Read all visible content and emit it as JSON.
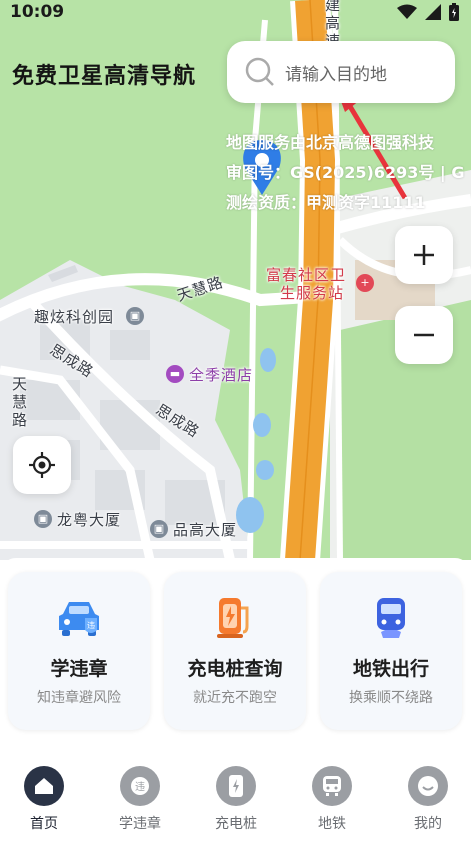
{
  "status": {
    "time": "10:09"
  },
  "app": {
    "title": "免费卫星高清导航"
  },
  "search": {
    "placeholder": "请输入目的地"
  },
  "map": {
    "attribution": [
      "地图服务由北京高德图强科技",
      "审图号：GS(2025)6293号 | G",
      "测绘资质：甲测资字11111"
    ],
    "road_labels": {
      "tianhui_road": "天慧路",
      "sicheng_road_a": "思成路",
      "sicheng_road_b": "思成路",
      "tianhui_road_v": "天慧路",
      "jiangao_road": "建高速"
    },
    "pois": {
      "quxuan": "趣炫科创园",
      "fuchun": "富春社区卫生服务站",
      "fuchun_line1": "富春社区卫",
      "fuchun_line2": "生服务站",
      "quanji": "全季酒店",
      "longyue": "龙粤大厦",
      "pingao": "品高大厦"
    },
    "buttons": {
      "zoom_in": "+",
      "zoom_out": "−"
    }
  },
  "cards": [
    {
      "title": "学违章",
      "subtitle": "知违章避风险",
      "icon": "car-violation-icon"
    },
    {
      "title": "充电桩查询",
      "subtitle": "就近充不跑空",
      "icon": "charging-pile-icon"
    },
    {
      "title": "地铁出行",
      "subtitle": "换乘顺不绕路",
      "icon": "subway-icon"
    }
  ],
  "nav": [
    {
      "label": "首页",
      "icon": "home-icon",
      "active": true
    },
    {
      "label": "学违章",
      "icon": "violation-icon",
      "active": false
    },
    {
      "label": "充电桩",
      "icon": "charger-icon",
      "active": false
    },
    {
      "label": "地铁",
      "icon": "metro-icon",
      "active": false
    },
    {
      "label": "我的",
      "icon": "profile-icon",
      "active": false
    }
  ],
  "colors": {
    "accent_blue": "#3d8bf0",
    "highway_orange": "#f0a232",
    "park_green": "#b7e3a6",
    "nav_active": "#2a3346",
    "annotation_red": "#e8343c"
  }
}
